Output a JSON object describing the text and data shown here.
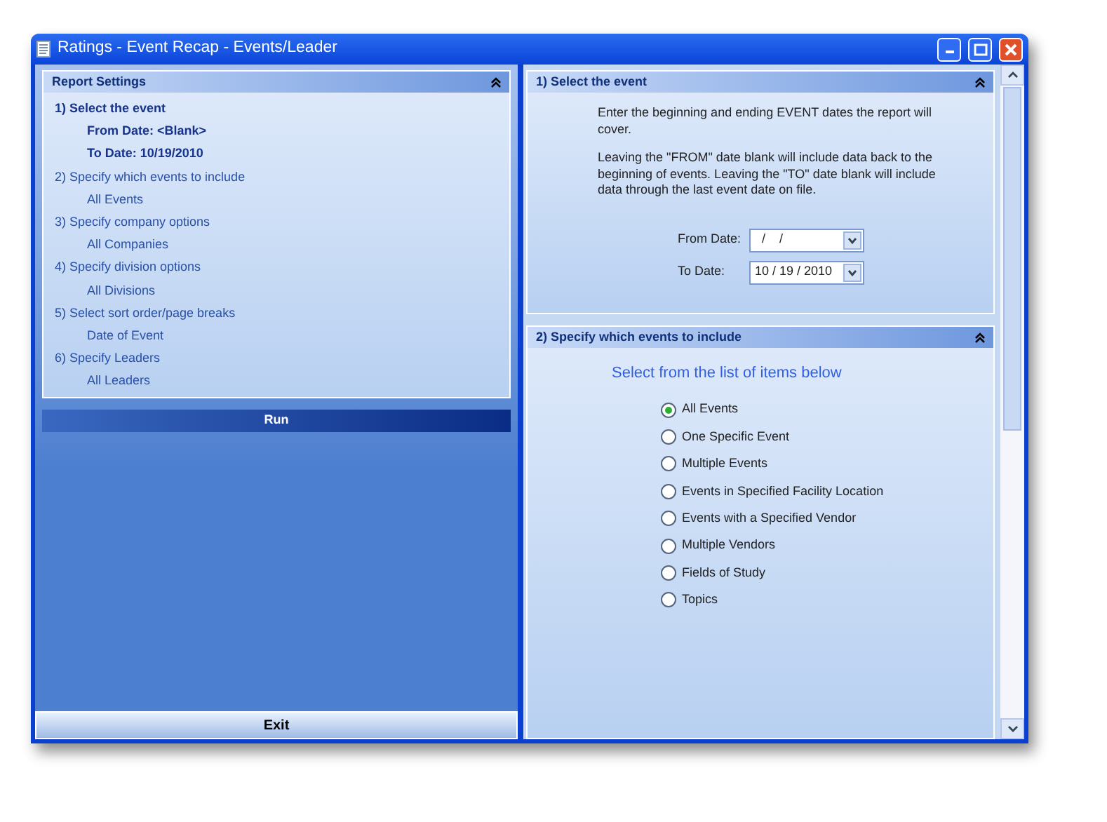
{
  "window": {
    "title": "Ratings - Event Recap - Events/Leader"
  },
  "report_settings": {
    "title": "Report Settings",
    "steps": [
      {
        "label": "1)  Select the event",
        "selected": true,
        "values": [
          "From Date:  <Blank>",
          "To Date:  10/19/2010"
        ]
      },
      {
        "label": "2)  Specify which events to include",
        "selected": false,
        "values": [
          "All Events"
        ]
      },
      {
        "label": "3)  Specify company options",
        "selected": false,
        "values": [
          "All Companies"
        ]
      },
      {
        "label": "4)  Specify division options",
        "selected": false,
        "values": [
          "All Divisions"
        ]
      },
      {
        "label": "5)  Select sort order/page breaks",
        "selected": false,
        "values": [
          "Date of Event"
        ]
      },
      {
        "label": "6)  Specify Leaders",
        "selected": false,
        "values": [
          "All Leaders"
        ]
      }
    ]
  },
  "run_button": "Run",
  "exit_button": "Exit",
  "select_event": {
    "title": "1)  Select the event",
    "paragraphs": [
      "Enter the beginning and ending EVENT dates the report will cover.",
      "Leaving the \"FROM\" date blank will include data back to the beginning of events. Leaving the \"TO\" date blank will include data through the last event date on file."
    ],
    "fields": [
      {
        "label": "From Date:",
        "value": "  /    /"
      },
      {
        "label": "To Date:",
        "value": "10 / 19 / 2010"
      }
    ]
  },
  "events_include": {
    "title": "2)  Specify which events to include",
    "prompt": "Select from the list of items below",
    "options": [
      {
        "label": "All Events",
        "selected": true
      },
      {
        "label": "One Specific Event",
        "selected": false
      },
      {
        "label": "Multiple Events",
        "selected": false
      },
      {
        "label": "Events in Specified Facility Location",
        "selected": false
      },
      {
        "label": "Events with a Specified Vendor",
        "selected": false
      },
      {
        "label": "Multiple Vendors",
        "selected": false
      },
      {
        "label": "Fields of Study",
        "selected": false
      },
      {
        "label": "Topics",
        "selected": false
      }
    ]
  }
}
